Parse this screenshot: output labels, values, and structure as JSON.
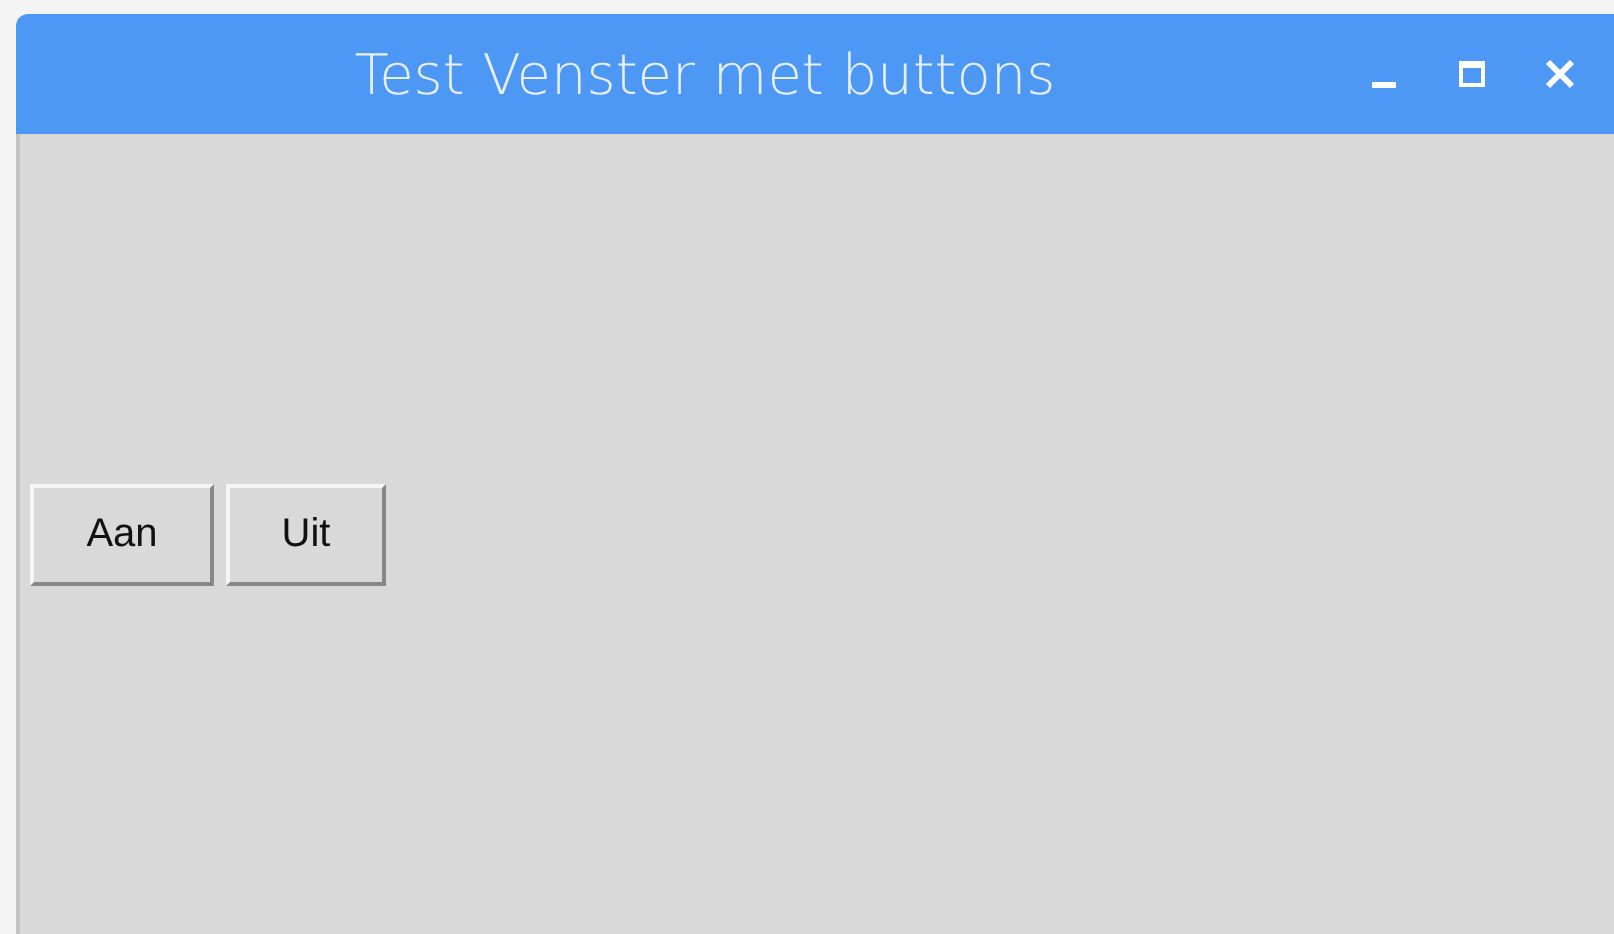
{
  "window": {
    "title": "Test Venster met buttons"
  },
  "buttons": [
    {
      "label": "Aan"
    },
    {
      "label": "Uit"
    }
  ]
}
